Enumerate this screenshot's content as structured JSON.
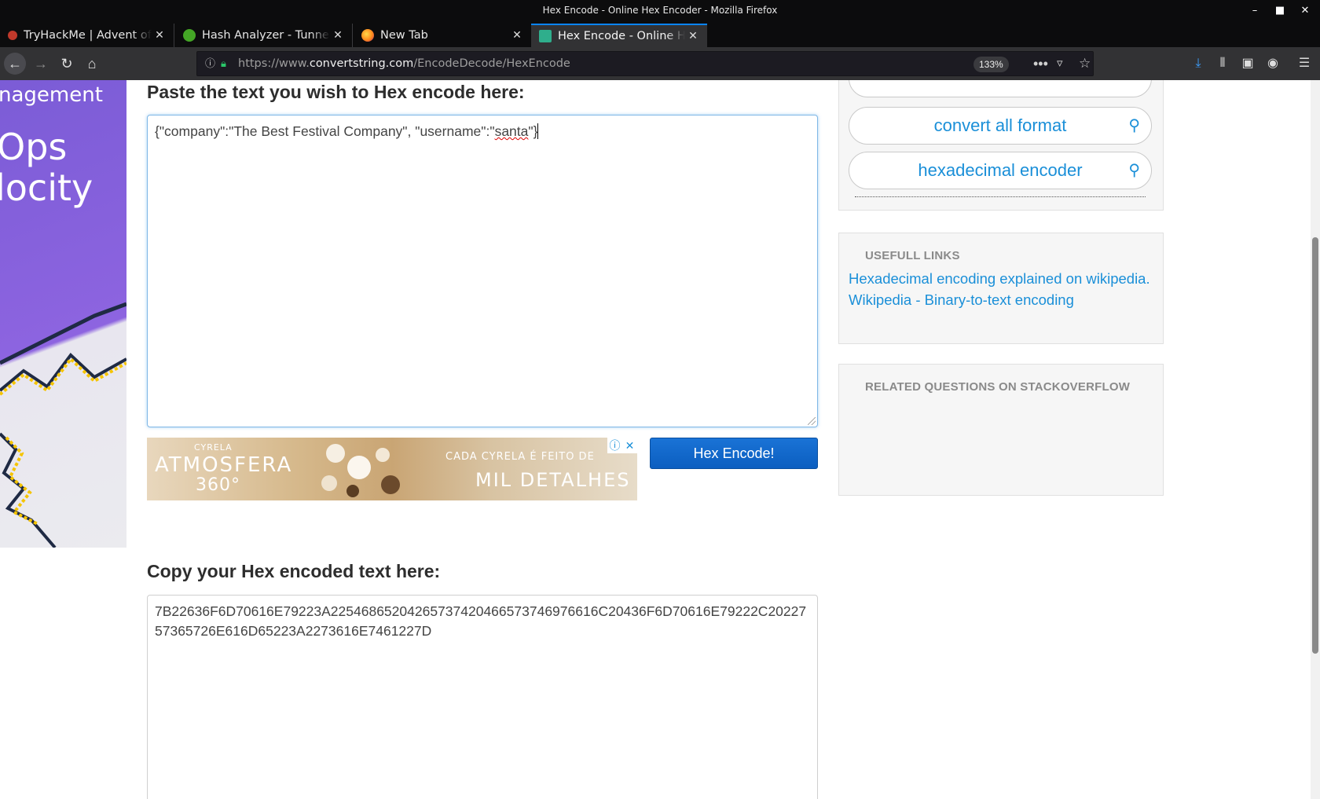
{
  "window": {
    "title": "Hex Encode - Online Hex Encoder - Mozilla Firefox"
  },
  "tabs": [
    {
      "label": "TryHackMe | Advent of Cyber",
      "favicon": "tryhackme-icon",
      "color": "#c0392b"
    },
    {
      "label": "Hash Analyzer - TunnelsUP",
      "favicon": "tunnelsup-icon",
      "color": "#44a626"
    },
    {
      "label": "New Tab",
      "favicon": "firefox-icon",
      "color": "#ff8a1c"
    },
    {
      "label": "Hex Encode - Online Hex Encoder",
      "favicon": "convertstring-icon",
      "color": "#2fae8c",
      "active": true
    }
  ],
  "nav": {
    "url_prefix": "https://www.",
    "url_domain": "convertstring.com",
    "url_path": "/EncodeDecode/HexEncode",
    "zoom": "133%"
  },
  "left_ad": {
    "line1": "nagement",
    "line2": "Ops",
    "line3": "locity"
  },
  "main": {
    "input_heading": "Paste the text you wish to Hex encode here:",
    "input_before": "{\"company\":\"The Best Festival Company\", \"username\":\"",
    "input_misspelled": "santa",
    "input_after": "\"}",
    "encode_button": "Hex Encode!",
    "output_heading": "Copy your Hex encoded text here:",
    "output_value": "7B22636F6D70616E79223A22546865204265737420466573746976616C20436F6D70616E79222C2022757365726E616D65223A2273616E7461227D"
  },
  "ad_banner": {
    "brand": "CYRELA",
    "name": "ATMOSFERA",
    "sub": "360°",
    "tagline1": "CADA CYRELA É FEITO DE",
    "tagline2": "MIL DETALHES"
  },
  "sidebar": {
    "search_pills": [
      "convert all format",
      "hexadecimal encoder"
    ],
    "useful_links_title": "USEFULL LINKS",
    "useful_links": [
      "Hexadecimal encoding explained on wikipedia.",
      "Wikipedia - Binary-to-text encoding"
    ],
    "related_title": "RELATED QUESTIONS ON STACKOVERFLOW"
  }
}
